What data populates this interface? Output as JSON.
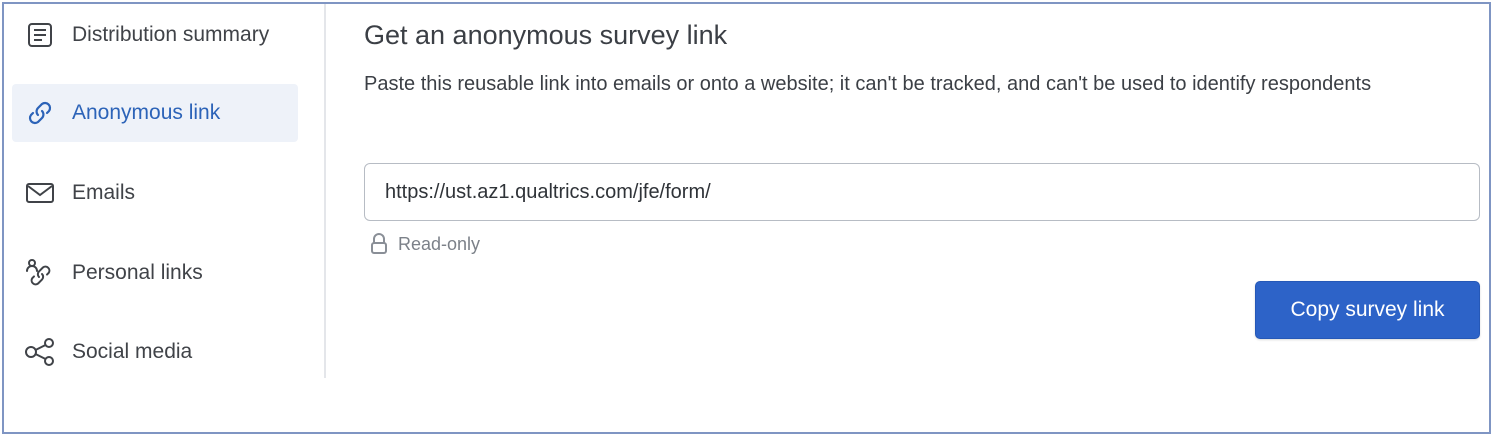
{
  "sidebar": {
    "items": [
      {
        "label": "Distribution summary",
        "icon": "document-list-icon",
        "active": false
      },
      {
        "label": "Anonymous link",
        "icon": "link-icon",
        "active": true
      },
      {
        "label": "Emails",
        "icon": "envelope-icon",
        "active": false
      },
      {
        "label": "Personal links",
        "icon": "personal-link-icon",
        "active": false
      },
      {
        "label": "Social media",
        "icon": "share-nodes-icon",
        "active": false
      }
    ]
  },
  "main": {
    "title": "Get an anonymous survey link",
    "description": "Paste this reusable link into emails or onto a website; it can't be tracked, and can't be used to identify respondents",
    "link_value": "https://ust.az1.qualtrics.com/jfe/form/",
    "readonly_label": "Read-only",
    "copy_button_label": "Copy survey link"
  },
  "colors": {
    "accent": "#2d63c8",
    "active_bg": "#eef2f9",
    "frame_border": "#7f95c3"
  }
}
